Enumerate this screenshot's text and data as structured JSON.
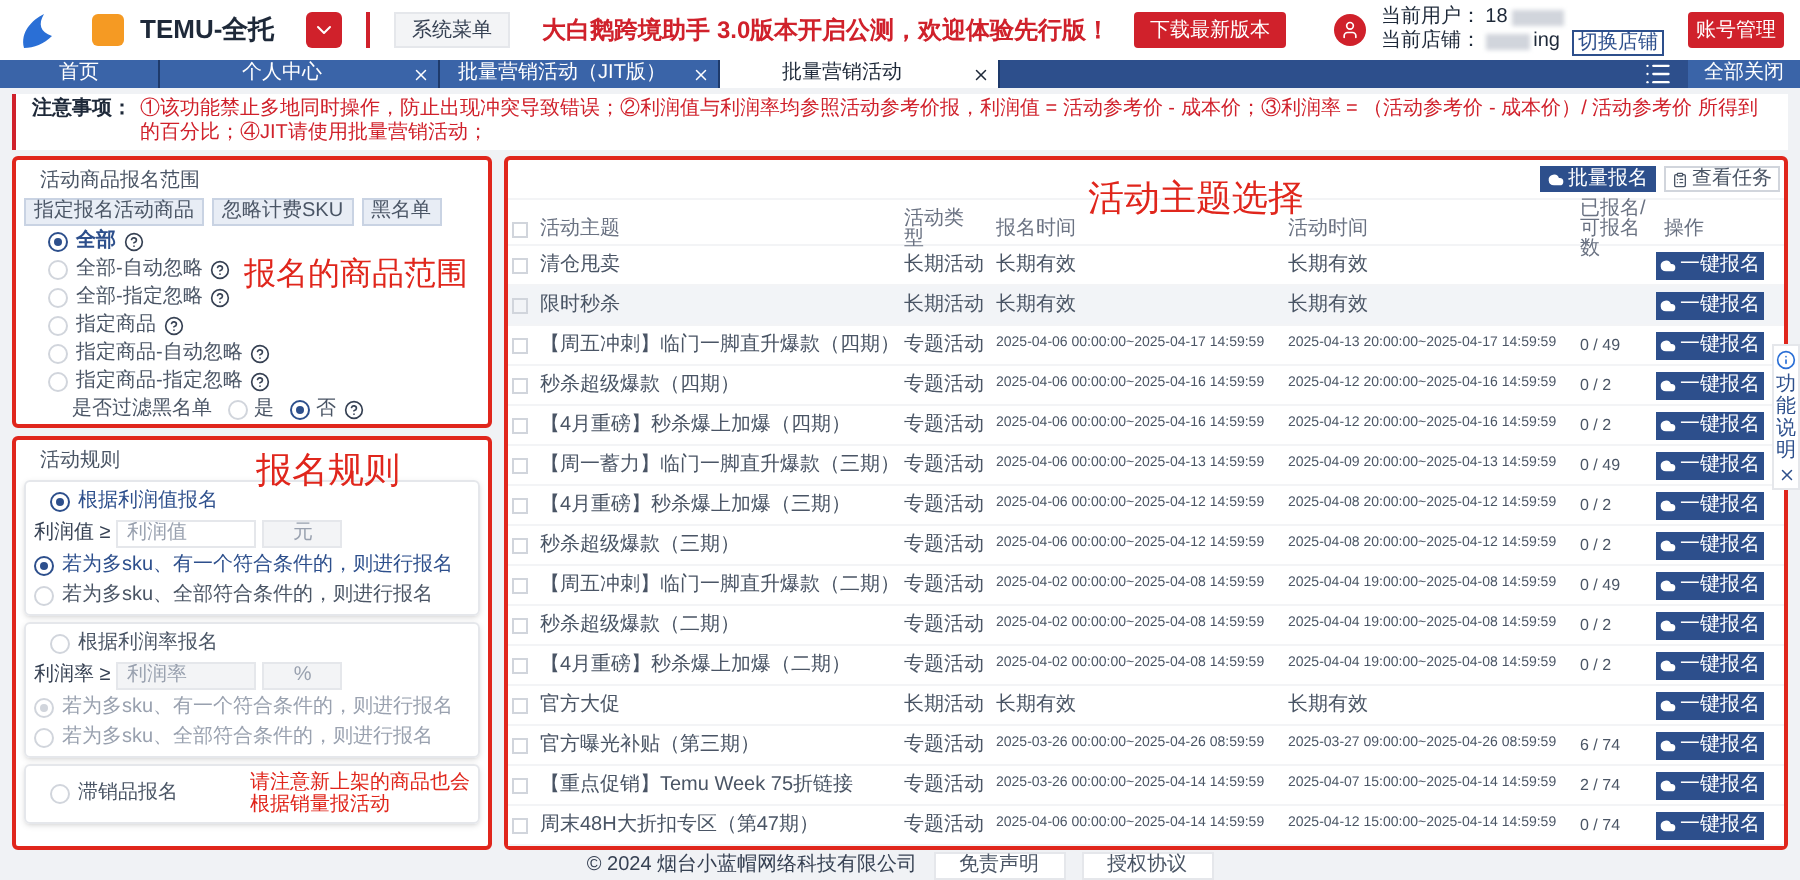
{
  "header": {
    "app_title": "TEMU-全托",
    "menu_button": "系统菜单",
    "banner": "大白鹅跨境助手 3.0版本开启公测，欢迎体验先行版！",
    "download_button": "下载最新版本",
    "user_label": "当前用户：",
    "user_value": "18",
    "shop_label": "当前店铺：",
    "shop_value": "ing",
    "switch_shop_button": "切换店铺",
    "account_button": "账号管理"
  },
  "tabs": [
    {
      "label": "首页",
      "closable": false,
      "selected": false
    },
    {
      "label": "个人中心",
      "closable": true,
      "selected": false
    },
    {
      "label": "批量营销活动（JIT版）",
      "closable": true,
      "selected": false
    },
    {
      "label": "批量营销活动",
      "closable": true,
      "selected": true
    }
  ],
  "close_all_button": "全部关闭",
  "notice": {
    "label": "注意事项：",
    "text": "①该功能禁止多地同时操作，防止出现冲突导致错误；②利润值与利润率均参照活动参考价报，利润值 = 活动参考价 - 成本价；③利润率 = （活动参考价 - 成本价）/ 活动参考价 所得到的百分比；④JIT请使用批量营销活动；"
  },
  "scope_panel": {
    "title": "活动商品报名范围",
    "annotation": "报名的商品范围",
    "buttons": [
      "指定报名活动商品",
      "忽略计费SKU",
      "黑名单"
    ],
    "options": [
      {
        "label": "全部",
        "selected": true
      },
      {
        "label": "全部-自动忽略",
        "selected": false
      },
      {
        "label": "全部-指定忽略",
        "selected": false
      },
      {
        "label": "指定商品",
        "selected": false
      },
      {
        "label": "指定商品-自动忽略",
        "selected": false
      },
      {
        "label": "指定商品-指定忽略",
        "selected": false
      }
    ],
    "blacklist": {
      "label": "是否过滤黑名单",
      "options": [
        {
          "label": "是",
          "selected": false
        },
        {
          "label": "否",
          "selected": true
        }
      ]
    }
  },
  "rules_panel": {
    "title": "活动规则",
    "annotation": "报名规则",
    "cards": [
      {
        "kind": "threshold",
        "label": "根据利润值报名",
        "selected": true,
        "disabled": false,
        "field_label": "利润值 ≥",
        "placeholder": "利润值",
        "unit": "元",
        "options": [
          {
            "label": "若为多sku、有一个符合条件的，则进行报名",
            "selected": true
          },
          {
            "label": "若为多sku、全部符合条件的，则进行报名",
            "selected": false
          }
        ]
      },
      {
        "kind": "threshold",
        "label": "根据利润率报名",
        "selected": false,
        "disabled": true,
        "field_label": "利润率 ≥",
        "placeholder": "利润率",
        "unit": "%",
        "options": [
          {
            "label": "若为多sku、有一个符合条件的，则进行报名",
            "selected": true
          },
          {
            "label": "若为多sku、全部符合条件的，则进行报名",
            "selected": false
          }
        ]
      },
      {
        "kind": "note",
        "label": "滞销品报名",
        "selected": false,
        "note": "请注意新上架的商品也会根据销量报活动"
      }
    ]
  },
  "activities": {
    "annotation": "活动主题选择",
    "batch_button": "批量报名",
    "tasks_button": "查看任务",
    "header_checked": false,
    "columns": [
      "活动主题",
      "活动类型",
      "报名时间",
      "活动时间",
      "已报名/可报名数",
      "操作"
    ],
    "rows": [
      {
        "checked": false,
        "highlighted": false,
        "theme": "清仓甩卖",
        "type": "长期活动",
        "signup_time": "长期有效",
        "activity_time": "长期有效",
        "action": "一键报名"
      },
      {
        "checked": false,
        "highlighted": true,
        "theme": "限时秒杀",
        "type": "长期活动",
        "signup_time": "长期有效",
        "activity_time": "长期有效",
        "action": "一键报名"
      },
      {
        "checked": false,
        "highlighted": false,
        "theme": "【周五冲刺】临门一脚直升爆款（四期）",
        "type": "专题活动",
        "signup_time": "2025-04-06 00:00:00~2025-04-17 14:59:59",
        "activity_time": "2025-04-13 20:00:00~2025-04-17 14:59:59",
        "count": "0 / 49",
        "action": "一键报名"
      },
      {
        "checked": false,
        "highlighted": false,
        "theme": "秒杀超级爆款（四期）",
        "type": "专题活动",
        "signup_time": "2025-04-06 00:00:00~2025-04-16 14:59:59",
        "activity_time": "2025-04-12 20:00:00~2025-04-16 14:59:59",
        "count": "0 / 2",
        "action": "一键报名"
      },
      {
        "checked": false,
        "highlighted": false,
        "theme": "【4月重磅】秒杀爆上加爆（四期）",
        "type": "专题活动",
        "signup_time": "2025-04-06 00:00:00~2025-04-16 14:59:59",
        "activity_time": "2025-04-12 20:00:00~2025-04-16 14:59:59",
        "count": "0 / 2",
        "action": "一键报名"
      },
      {
        "checked": false,
        "highlighted": false,
        "theme": "【周一蓄力】临门一脚直升爆款（三期）",
        "type": "专题活动",
        "signup_time": "2025-04-06 00:00:00~2025-04-13 14:59:59",
        "activity_time": "2025-04-09 20:00:00~2025-04-13 14:59:59",
        "count": "0 / 49",
        "action": "一键报名"
      },
      {
        "checked": false,
        "highlighted": false,
        "theme": "【4月重磅】秒杀爆上加爆（三期）",
        "type": "专题活动",
        "signup_time": "2025-04-06 00:00:00~2025-04-12 14:59:59",
        "activity_time": "2025-04-08 20:00:00~2025-04-12 14:59:59",
        "count": "0 / 2",
        "action": "一键报名"
      },
      {
        "checked": false,
        "highlighted": false,
        "theme": "秒杀超级爆款（三期）",
        "type": "专题活动",
        "signup_time": "2025-04-06 00:00:00~2025-04-12 14:59:59",
        "activity_time": "2025-04-08 20:00:00~2025-04-12 14:59:59",
        "count": "0 / 2",
        "action": "一键报名"
      },
      {
        "checked": false,
        "highlighted": false,
        "theme": "【周五冲刺】临门一脚直升爆款（二期）",
        "type": "专题活动",
        "signup_time": "2025-04-02 00:00:00~2025-04-08 14:59:59",
        "activity_time": "2025-04-04 19:00:00~2025-04-08 14:59:59",
        "count": "0 / 49",
        "action": "一键报名"
      },
      {
        "checked": false,
        "highlighted": false,
        "theme": "秒杀超级爆款（二期）",
        "type": "专题活动",
        "signup_time": "2025-04-02 00:00:00~2025-04-08 14:59:59",
        "activity_time": "2025-04-04 19:00:00~2025-04-08 14:59:59",
        "count": "0 / 2",
        "action": "一键报名"
      },
      {
        "checked": false,
        "highlighted": false,
        "theme": "【4月重磅】秒杀爆上加爆（二期）",
        "type": "专题活动",
        "signup_time": "2025-04-02 00:00:00~2025-04-08 14:59:59",
        "activity_time": "2025-04-04 19:00:00~2025-04-08 14:59:59",
        "count": "0 / 2",
        "action": "一键报名"
      },
      {
        "checked": false,
        "highlighted": false,
        "theme": "官方大促",
        "type": "长期活动",
        "signup_time": "长期有效",
        "activity_time": "长期有效",
        "action": "一键报名"
      },
      {
        "checked": false,
        "highlighted": false,
        "theme": "官方曝光补贴（第三期）",
        "type": "专题活动",
        "signup_time": "2025-03-26 00:00:00~2025-04-26 08:59:59",
        "activity_time": "2025-03-27 09:00:00~2025-04-26 08:59:59",
        "count": "6 / 74",
        "action": "一键报名"
      },
      {
        "checked": false,
        "highlighted": false,
        "theme": "【重点促销】Temu Week 75折链接",
        "type": "专题活动",
        "signup_time": "2025-03-26 00:00:00~2025-04-14 14:59:59",
        "activity_time": "2025-04-07 15:00:00~2025-04-14 14:59:59",
        "count": "2 / 74",
        "action": "一键报名"
      },
      {
        "checked": false,
        "highlighted": false,
        "theme": "周末48H大折扣专区（第47期）",
        "type": "专题活动",
        "signup_time": "2025-04-06 00:00:00~2025-04-14 14:59:59",
        "activity_time": "2025-04-12 15:00:00~2025-04-14 14:59:59",
        "count": "0 / 74",
        "action": "一键报名"
      }
    ]
  },
  "side_help": {
    "label": "功能说明"
  },
  "footer": {
    "copyright": "© 2024 烟台小蓝帽网络科技有限公司",
    "links": [
      "免责声明",
      "授权协议"
    ]
  }
}
